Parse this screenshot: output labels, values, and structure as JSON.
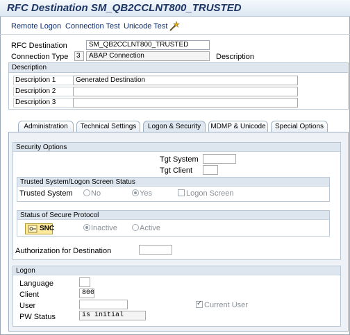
{
  "window": {
    "title": "RFC Destination SM_QB2CCLNT800_TRUSTED"
  },
  "toolbar": {
    "remote_logon": "Remote Logon",
    "connection_test": "Connection Test",
    "unicode_test": "Unicode Test",
    "wand_icon": "magic-wand-icon"
  },
  "header": {
    "rfc_destination_label": "RFC Destination",
    "rfc_destination_value": "SM_QB2CCLNT800_TRUSTED",
    "connection_type_label": "Connection Type",
    "connection_type_code": "3",
    "connection_type_value": "ABAP Connection",
    "description_label": "Description"
  },
  "description": {
    "heading": "Description",
    "rows": [
      {
        "label": "Description 1",
        "value": "Generated Destination"
      },
      {
        "label": "Description 2",
        "value": ""
      },
      {
        "label": "Description 3",
        "value": ""
      }
    ]
  },
  "tabs": [
    {
      "label": "Administration"
    },
    {
      "label": "Technical Settings"
    },
    {
      "label": "Logon & Security",
      "active": true
    },
    {
      "label": "MDMP & Unicode"
    },
    {
      "label": "Special Options"
    }
  ],
  "security": {
    "heading": "Security Options",
    "tgt_system_label": "Tgt System",
    "tgt_client_label": "Tgt Client",
    "trusted": {
      "heading": "Trusted System/Logon Screen Status",
      "label": "Trusted System",
      "no": "No",
      "yes": "Yes",
      "logon_screen": "Logon Screen"
    },
    "secure": {
      "heading": "Status of Secure Protocol",
      "snc_label": "SNC",
      "inactive": "Inactive",
      "active": "Active"
    },
    "authorization_label": "Authorization for Destination"
  },
  "logon": {
    "heading": "Logon",
    "language_label": "Language",
    "client_label": "Client",
    "client_value": "800",
    "user_label": "User",
    "current_user": "Current User",
    "pw_status_label": "PW Status",
    "pw_status_value": "is initial"
  }
}
